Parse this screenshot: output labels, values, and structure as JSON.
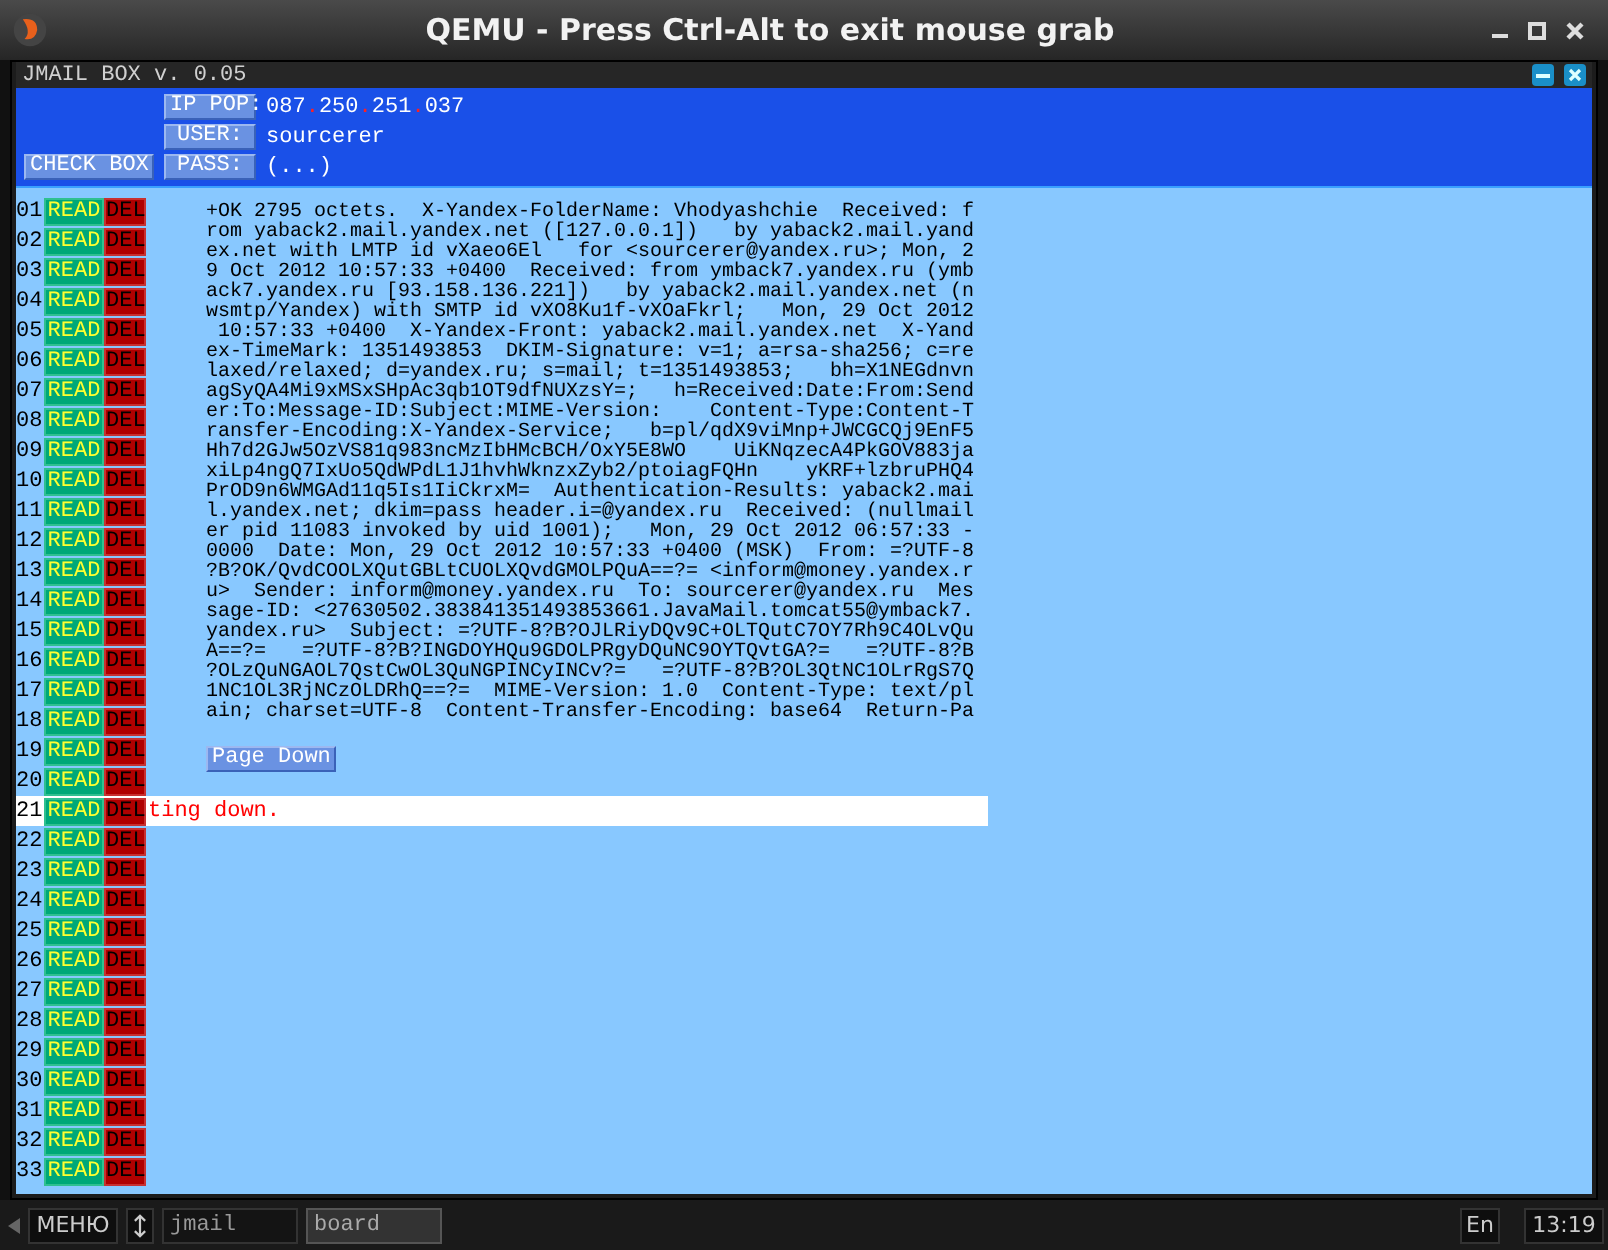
{
  "window": {
    "title": "QEMU - Press Ctrl-Alt to exit mouse grab"
  },
  "app": {
    "title": "JMAIL BOX v. 0.05"
  },
  "header": {
    "check_button": "CHECK BOX",
    "fields": [
      {
        "label": "IP POP:",
        "value": "087.250.251.037",
        "kind": "ip"
      },
      {
        "label": "USER:",
        "value": "sourcerer",
        "kind": "text"
      },
      {
        "label": "PASS:",
        "value": "(...)",
        "kind": "text"
      }
    ]
  },
  "rows": [
    {
      "number": "01",
      "read": "READ",
      "del": "DEL",
      "selected": false
    },
    {
      "number": "02",
      "read": "READ",
      "del": "DEL",
      "selected": false
    },
    {
      "number": "03",
      "read": "READ",
      "del": "DEL",
      "selected": false
    },
    {
      "number": "04",
      "read": "READ",
      "del": "DEL",
      "selected": false
    },
    {
      "number": "05",
      "read": "READ",
      "del": "DEL",
      "selected": false
    },
    {
      "number": "06",
      "read": "READ",
      "del": "DEL",
      "selected": false
    },
    {
      "number": "07",
      "read": "READ",
      "del": "DEL",
      "selected": false
    },
    {
      "number": "08",
      "read": "READ",
      "del": "DEL",
      "selected": false
    },
    {
      "number": "09",
      "read": "READ",
      "del": "DEL",
      "selected": false
    },
    {
      "number": "10",
      "read": "READ",
      "del": "DEL",
      "selected": false
    },
    {
      "number": "11",
      "read": "READ",
      "del": "DEL",
      "selected": false
    },
    {
      "number": "12",
      "read": "READ",
      "del": "DEL",
      "selected": false
    },
    {
      "number": "13",
      "read": "READ",
      "del": "DEL",
      "selected": false
    },
    {
      "number": "14",
      "read": "READ",
      "del": "DEL",
      "selected": false
    },
    {
      "number": "15",
      "read": "READ",
      "del": "DEL",
      "selected": false
    },
    {
      "number": "16",
      "read": "READ",
      "del": "DEL",
      "selected": false
    },
    {
      "number": "17",
      "read": "READ",
      "del": "DEL",
      "selected": false
    },
    {
      "number": "18",
      "read": "READ",
      "del": "DEL",
      "selected": false
    },
    {
      "number": "19",
      "read": "READ",
      "del": "DEL",
      "selected": false
    },
    {
      "number": "20",
      "read": "READ",
      "del": "DEL",
      "selected": false
    },
    {
      "number": "21",
      "read": "READ",
      "del": "DEL",
      "selected": true,
      "note": "ting down."
    },
    {
      "number": "22",
      "read": "READ",
      "del": "DEL",
      "selected": false
    },
    {
      "number": "23",
      "read": "READ",
      "del": "DEL",
      "selected": false
    },
    {
      "number": "24",
      "read": "READ",
      "del": "DEL",
      "selected": false
    },
    {
      "number": "25",
      "read": "READ",
      "del": "DEL",
      "selected": false
    },
    {
      "number": "26",
      "read": "READ",
      "del": "DEL",
      "selected": false
    },
    {
      "number": "27",
      "read": "READ",
      "del": "DEL",
      "selected": false
    },
    {
      "number": "28",
      "read": "READ",
      "del": "DEL",
      "selected": false
    },
    {
      "number": "29",
      "read": "READ",
      "del": "DEL",
      "selected": false
    },
    {
      "number": "30",
      "read": "READ",
      "del": "DEL",
      "selected": false
    },
    {
      "number": "31",
      "read": "READ",
      "del": "DEL",
      "selected": false
    },
    {
      "number": "32",
      "read": "READ",
      "del": "DEL",
      "selected": false
    },
    {
      "number": "33",
      "read": "READ",
      "del": "DEL",
      "selected": false
    }
  ],
  "message": {
    "lines": [
      "+OK 2795 octets.  X-Yandex-FolderName: Vhodyashchie  Received: f",
      "rom yaback2.mail.yandex.net ([127.0.0.1])   by yaback2.mail.yand",
      "ex.net with LMTP id vXaeo6El   for <sourcerer@yandex.ru>; Mon, 2",
      "9 Oct 2012 10:57:33 +0400  Received: from ymback7.yandex.ru (ymb",
      "ack7.yandex.ru [93.158.136.221])   by yaback2.mail.yandex.net (n",
      "wsmtp/Yandex) with SMTP id vXO8Ku1f-vXOaFkrl;   Mon, 29 Oct 2012",
      " 10:57:33 +0400  X-Yandex-Front: yaback2.mail.yandex.net  X-Yand",
      "ex-TimeMark: 1351493853  DKIM-Signature: v=1; a=rsa-sha256; c=re",
      "laxed/relaxed; d=yandex.ru; s=mail; t=1351493853;   bh=X1NEGdnvn",
      "agSyQA4Mi9xMSxSHpAc3qb1OT9dfNUXzsY=;   h=Received:Date:From:Send",
      "er:To:Message-ID:Subject:MIME-Version:    Content-Type:Content-T",
      "ransfer-Encoding:X-Yandex-Service;   b=pl/qdX9viMnp+JWCGCQj9EnF5",
      "Hh7d2GJw5OzVS81q983ncMzIbHMcBCH/OxY5E8WO    UiKNqzecA4PkGOV883ja",
      "xiLp4ngQ7IxUo5QdWPdL1J1hvhWknzxZyb2/ptoiagFQHn    yKRF+lzbruPHQ4",
      "PrOD9n6WMGAd11q5Is1IiCkrxM=  Authentication-Results: yaback2.mai",
      "l.yandex.net; dkim=pass header.i=@yandex.ru  Received: (nullmail",
      "er pid 11083 invoked by uid 1001);   Mon, 29 Oct 2012 06:57:33 -",
      "0000  Date: Mon, 29 Oct 2012 10:57:33 +0400 (MSK)  From: =?UTF-8",
      "?B?OK/QvdCOOLXQutGBLtCUOLXQvdGMOLPQuA==?= <inform@money.yandex.r",
      "u>  Sender: inform@money.yandex.ru  To: sourcerer@yandex.ru  Mes",
      "sage-ID: <27630502.383841351493853661.JavaMail.tomcat55@ymback7.",
      "yandex.ru>  Subject: =?UTF-8?B?OJLRiyDQv9C+OLTQutC7OY7Rh9C4OLvQu",
      "A==?=   =?UTF-8?B?INGDOYHQu9GDOLPRgyDQuNC9OYTQvtGA?=   =?UTF-8?B",
      "?OLzQuNGAOL7QstCwOL3QuNGPINCyINCv?=   =?UTF-8?B?OL3QtNC1OLrRgS7Q",
      "1NC1OL3RjNCzOLDRhQ==?=  MIME-Version: 1.0  Content-Type: text/pl",
      "ain; charset=UTF-8  Content-Transfer-Encoding: base64  Return-Pa"
    ],
    "page_down": "Page Down"
  },
  "taskbar": {
    "menu": "МЕНЮ",
    "tasks": [
      {
        "label": "jmail",
        "selected": false
      },
      {
        "label": "board",
        "selected": true
      }
    ],
    "language": "En",
    "clock": "13:19"
  }
}
